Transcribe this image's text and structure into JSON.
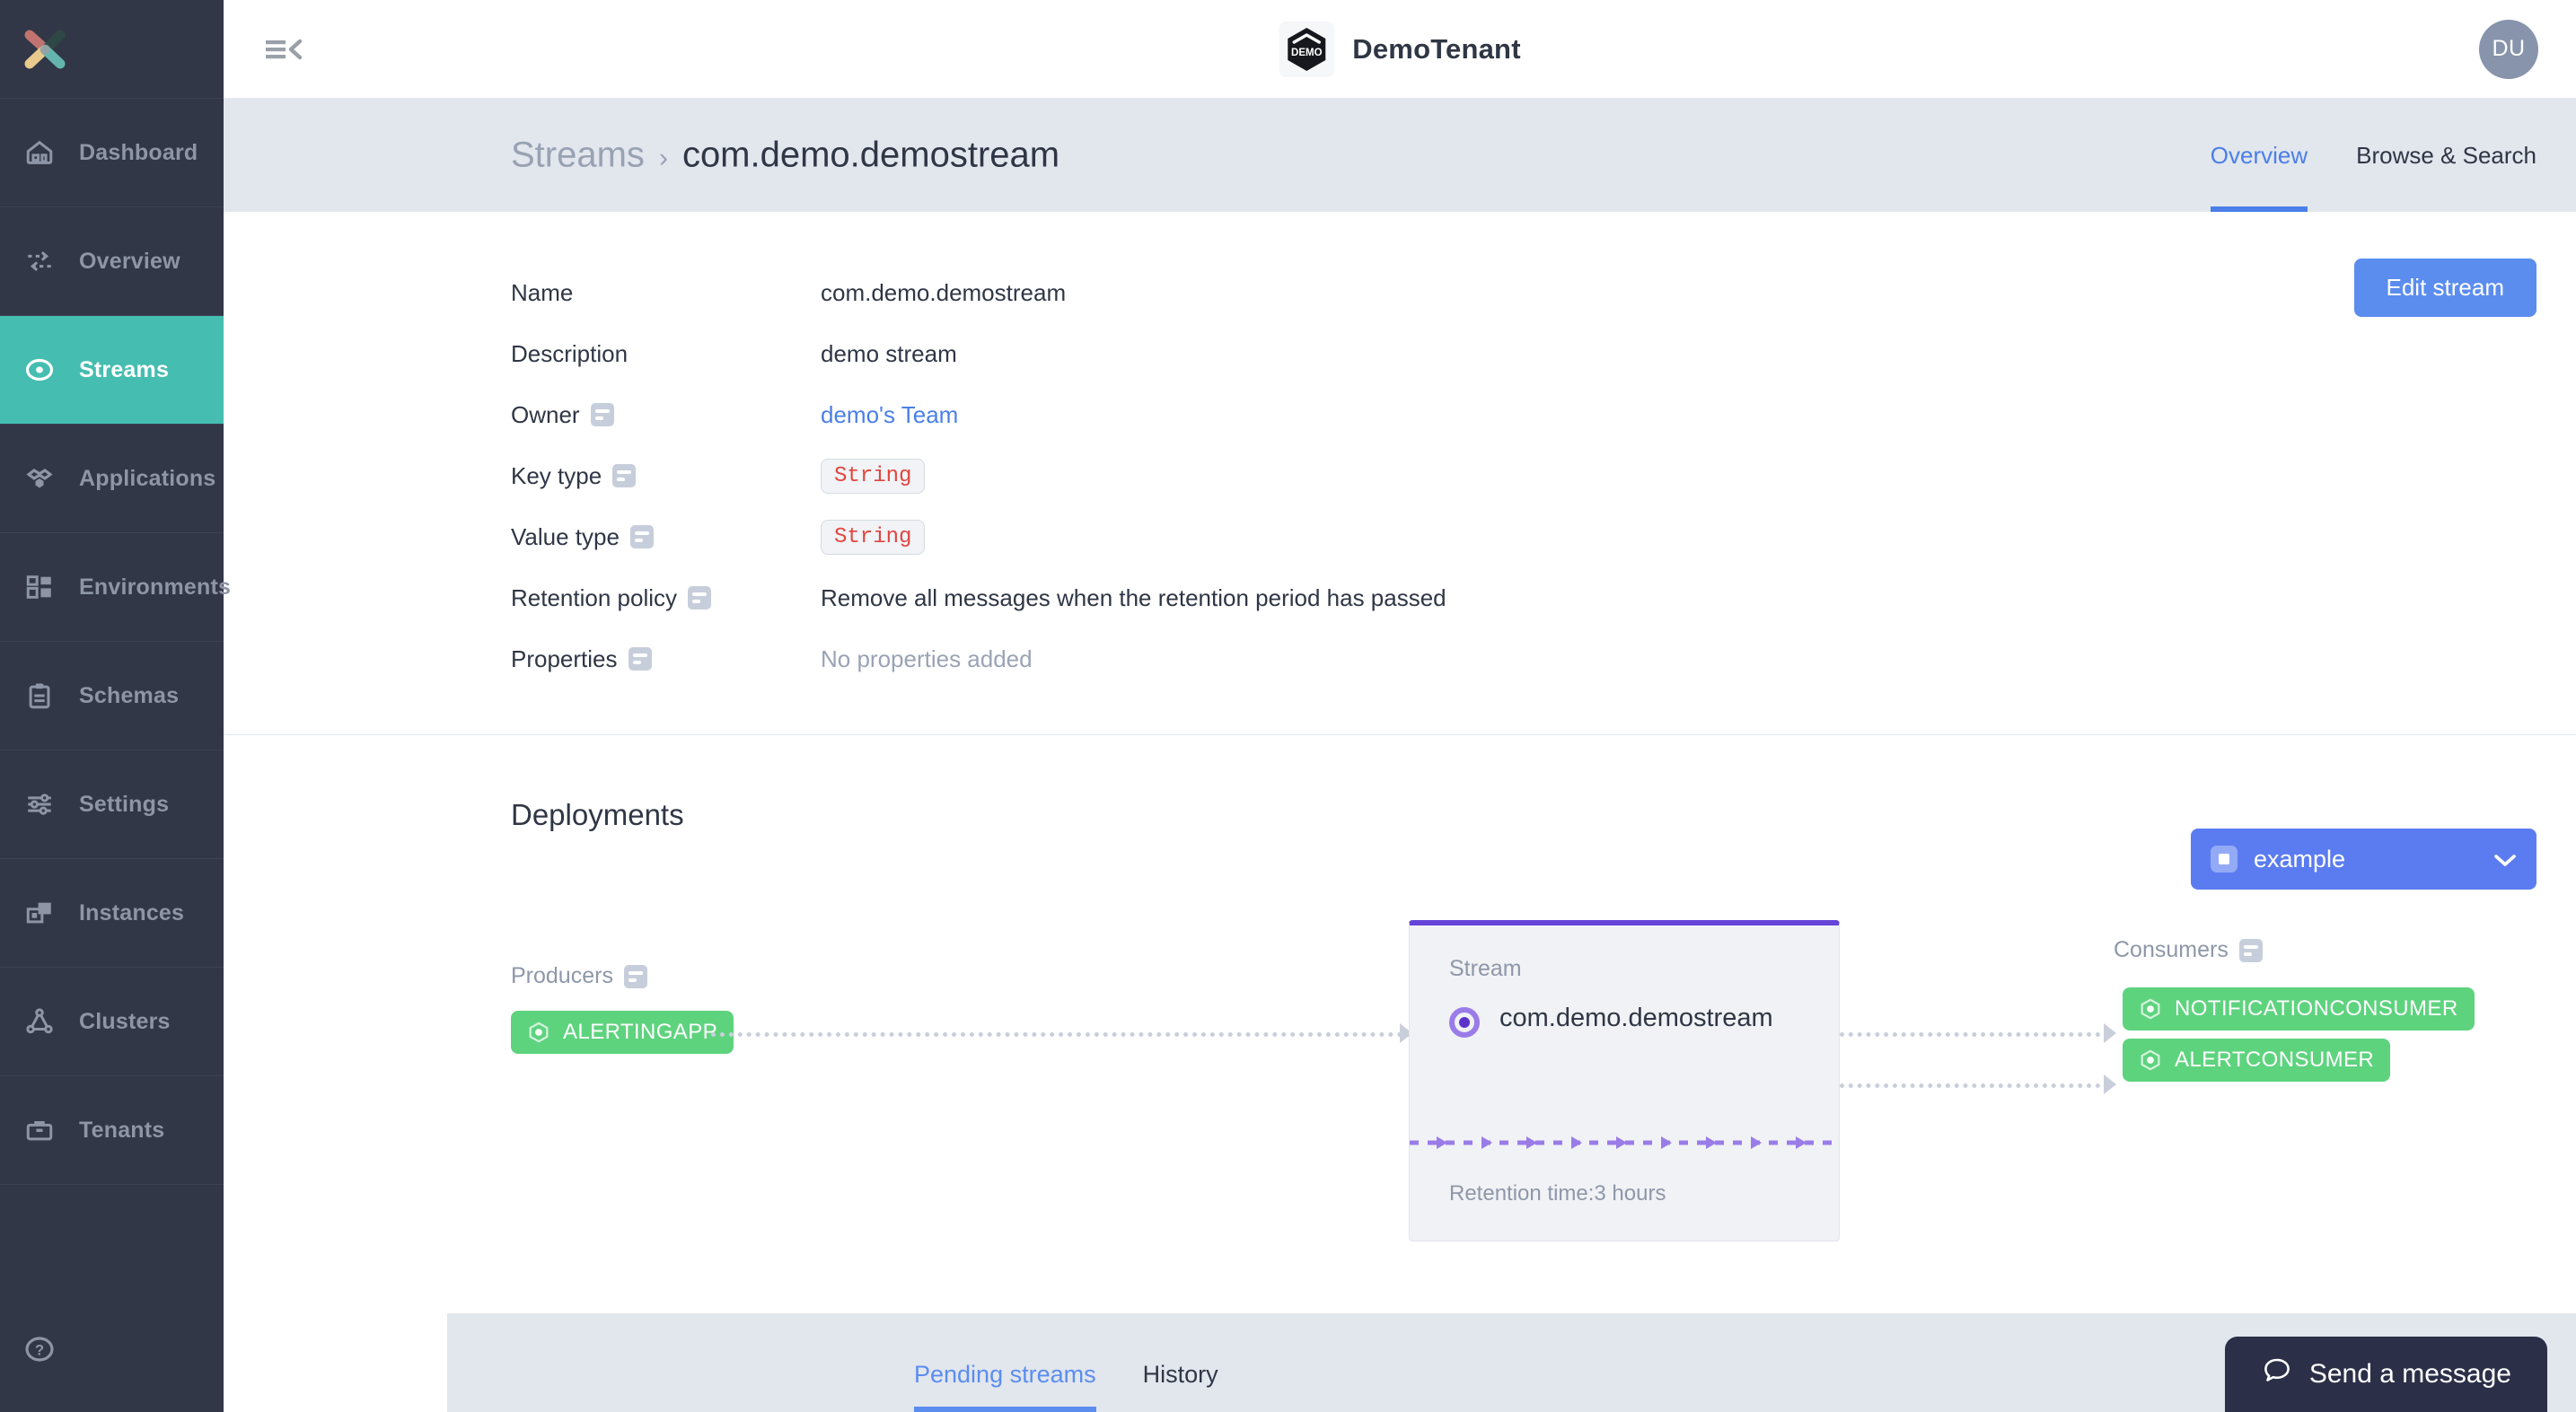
{
  "sidebar": {
    "logo_name": "x-logo",
    "items": [
      {
        "label": "Dashboard",
        "icon": "home-icon",
        "active": false
      },
      {
        "label": "Overview",
        "icon": "exchange-icon",
        "active": false
      },
      {
        "label": "Streams",
        "icon": "stream-icon",
        "active": true
      },
      {
        "label": "Applications",
        "icon": "applications-icon",
        "active": false
      },
      {
        "label": "Environments",
        "icon": "grid-icon",
        "active": false
      },
      {
        "label": "Schemas",
        "icon": "clipboard-icon",
        "active": false
      },
      {
        "label": "Settings",
        "icon": "sliders-icon",
        "active": false
      },
      {
        "label": "Instances",
        "icon": "windows-icon",
        "active": false
      },
      {
        "label": "Clusters",
        "icon": "cluster-icon",
        "active": false
      },
      {
        "label": "Tenants",
        "icon": "toolbox-icon",
        "active": false
      }
    ],
    "help_icon": "help-circle-icon"
  },
  "topbar": {
    "collapse_icon": "menu-collapse-icon",
    "tenant_logo_text": "DEMO",
    "tenant_name": "DemoTenant",
    "avatar_initials": "DU"
  },
  "breadcrumb": {
    "parent": "Streams",
    "separator": "›",
    "current": "com.demo.demostream"
  },
  "page_tabs": [
    {
      "label": "Overview",
      "active": true
    },
    {
      "label": "Browse & Search",
      "active": false
    }
  ],
  "details": {
    "edit_button": "Edit stream",
    "rows": [
      {
        "label": "Name",
        "has_info": false,
        "value": "com.demo.demostream",
        "style": "text"
      },
      {
        "label": "Description",
        "has_info": false,
        "value": "demo stream",
        "style": "text"
      },
      {
        "label": "Owner",
        "has_info": true,
        "value": "demo's Team",
        "style": "link"
      },
      {
        "label": "Key type",
        "has_info": true,
        "value": "String",
        "style": "chip"
      },
      {
        "label": "Value type",
        "has_info": true,
        "value": "String",
        "style": "chip"
      },
      {
        "label": "Retention policy",
        "has_info": true,
        "value": "Remove all messages when the retention period has passed",
        "style": "text"
      },
      {
        "label": "Properties",
        "has_info": true,
        "value": "No properties added",
        "style": "muted"
      }
    ]
  },
  "deployments": {
    "title": "Deployments",
    "environment_selected": "example",
    "producers_label": "Producers",
    "consumers_label": "Consumers",
    "producers": [
      {
        "label": "ALERTINGAPP"
      }
    ],
    "consumers": [
      {
        "label": "NOTIFICATIONCONSUMER"
      },
      {
        "label": "ALERTCONSUMER"
      }
    ],
    "stream_card": {
      "kind_label": "Stream",
      "name": "com.demo.demostream",
      "retention": "Retention time:3 hours"
    }
  },
  "bottom_tabs": [
    {
      "label": "Pending streams",
      "active": true
    },
    {
      "label": "History",
      "active": false
    }
  ],
  "chat": {
    "icon": "chat-bubble-icon",
    "label": "Send a message"
  },
  "colors": {
    "sidebar_bg": "#313746",
    "sidebar_active": "#45bdb0",
    "accent_blue": "#5b8def",
    "env_blue": "#5b7cf0",
    "node_green": "#5ed37e",
    "stream_purple": "#6544d8",
    "chip_red": "#e1453f",
    "crumb_bg": "#e2e6ed",
    "chat_bg": "#2b2f48"
  }
}
